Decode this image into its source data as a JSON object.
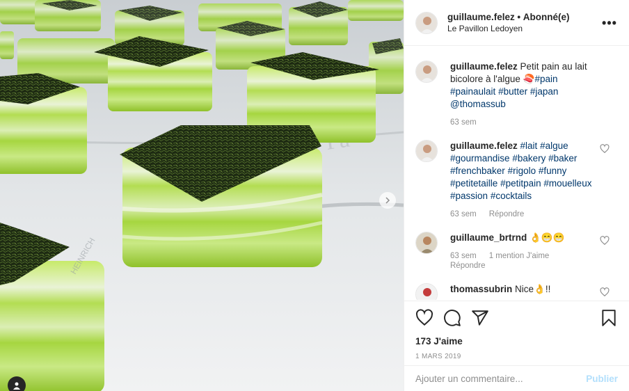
{
  "post": {
    "author": {
      "username": "guillaume.felez",
      "separator": "•",
      "follow_label": "Abonné(e)",
      "location": "Le Pavillon Ledoyen"
    },
    "more_icon": "more-horizontal-icon"
  },
  "comments": [
    {
      "username": "guillaume.felez",
      "text": "Petit pain au lait bicolore à l'algue 🍣",
      "tags": [
        "#pain",
        "#painaulait",
        "#butter",
        "#japan",
        "@thomassub"
      ],
      "time": "63 sem",
      "likes": "",
      "reply": ""
    },
    {
      "username": "guillaume.felez",
      "text": "",
      "tags": [
        "#lait",
        "#algue",
        "#gourmandise",
        "#bakery",
        "#baker",
        "#frenchbaker",
        "#rigolo",
        "#funny",
        "#petitetaille",
        "#petitpain",
        "#mouelleux",
        "#passion",
        "#cocktails"
      ],
      "time": "63 sem",
      "likes": "",
      "reply": "Répondre"
    },
    {
      "username": "guillaume_brtrnd",
      "text": "👌😁😁",
      "tags": [],
      "time": "63 sem",
      "likes": "1 mention J'aime",
      "reply": "Répondre"
    },
    {
      "username": "thomassubrin",
      "text": "Nice👌!!",
      "tags": [],
      "time": "",
      "likes": "",
      "reply": ""
    }
  ],
  "actions": {
    "icons": [
      "heart-icon",
      "comment-icon",
      "share-icon",
      "bookmark-icon"
    ],
    "likes_count": "173 J'aime",
    "date": "1 MARS 2019"
  },
  "composer": {
    "placeholder": "Ajouter un commentaire...",
    "publish_label": "Publier"
  },
  "colors": {
    "link": "#00376b",
    "muted": "#8e8e8e",
    "publish_disabled": "#b2dffc",
    "bread_green": "#a8d84a"
  }
}
